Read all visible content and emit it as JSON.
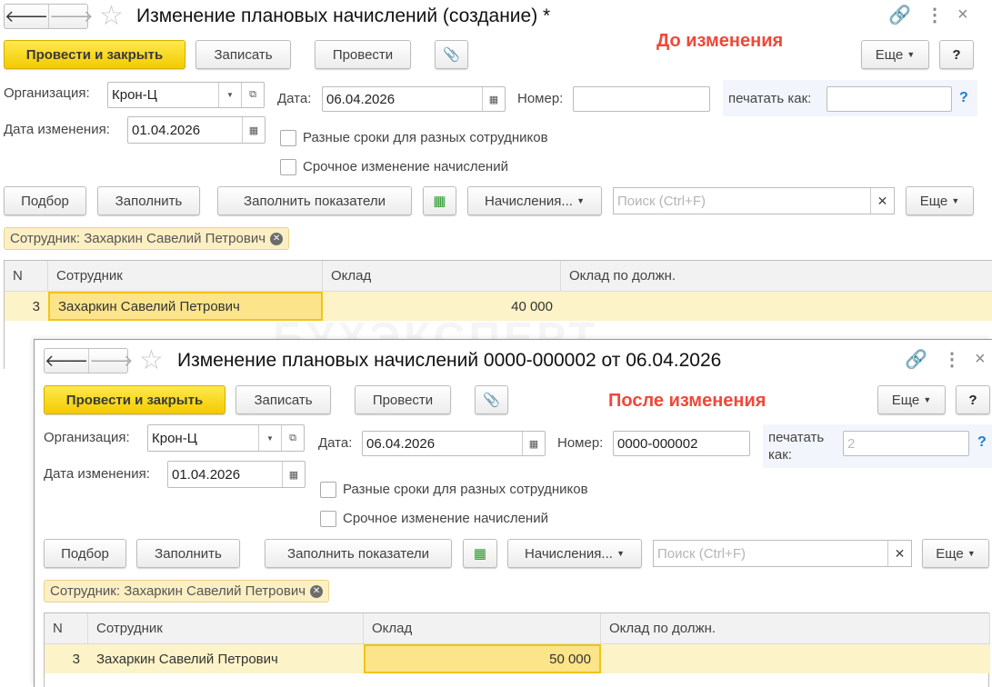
{
  "common": {
    "post_close": "Провести и закрыть",
    "save": "Записать",
    "post": "Провести",
    "more": "Еще",
    "help": "?",
    "org_label": "Организация:",
    "org_value": "Крон-Ц",
    "date_label": "Дата:",
    "date_value": "06.04.2026",
    "number_label": "Номер:",
    "print_as_label": "печатать как:",
    "change_date_label": "Дата изменения:",
    "change_date_value": "01.04.2026",
    "cb_diff_terms": "Разные сроки для разных сотрудников",
    "cb_urgent": "Срочное изменение начислений",
    "pick": "Подбор",
    "fill": "Заполнить",
    "fill_indicators": "Заполнить показатели",
    "accruals": "Начисления...",
    "search_placeholder": "Поиск (Ctrl+F)",
    "filter_tag": "Сотрудник: Захаркин Савелий Петрович",
    "columns": [
      "N",
      "Сотрудник",
      "Оклад",
      "Оклад по должн."
    ],
    "watermark": "БУХЭКСПЕРТ"
  },
  "win1": {
    "title": "Изменение плановых начислений (создание) *",
    "annotation": "До изменения",
    "number_value": "",
    "print_as_value": "",
    "row": {
      "n": "3",
      "employee": "Захаркин Савелий Петрович",
      "salary": "40 000",
      "salary_position": ""
    }
  },
  "win2": {
    "title": "Изменение плановых начислений 0000-000002 от 06.04.2026",
    "annotation": "После изменения",
    "number_value": "0000-000002",
    "print_as_label_1": "печатать",
    "print_as_label_2": "как:",
    "print_as_placeholder": "2",
    "row": {
      "n": "3",
      "employee": "Захаркин Савелий Петрович",
      "salary": "50 000",
      "salary_position": ""
    }
  },
  "colors": {
    "accent_yellow": "#f2cb00",
    "annotation_red": "#f0483a",
    "row_highlight": "#fdf3c8"
  }
}
